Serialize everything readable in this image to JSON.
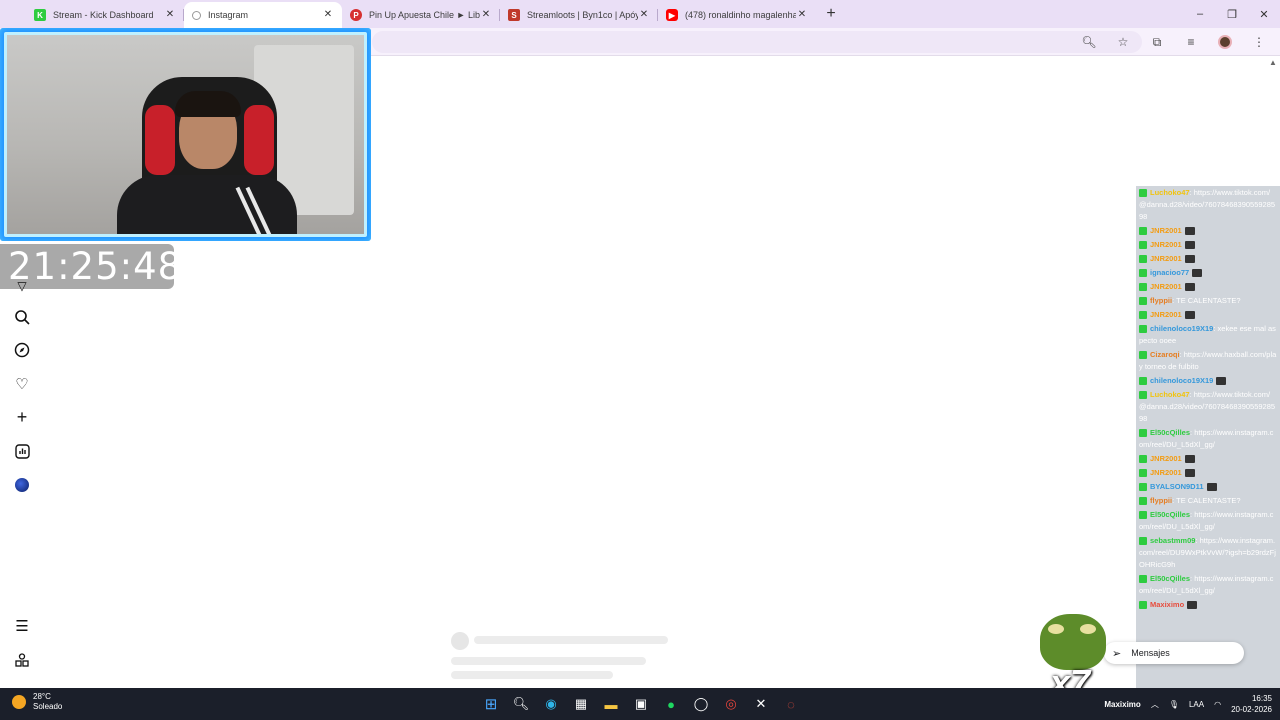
{
  "tabs": [
    {
      "title": "Stream - Kick Dashboard",
      "favicon": "kick-icon",
      "color": "#2ecc40",
      "active": false
    },
    {
      "title": "Instagram",
      "favicon": "loading-icon",
      "color": "#999999",
      "active": true
    },
    {
      "title": "Pin Up Apuesta Chile ► Libro D",
      "favicon": "pinup-icon",
      "color": "#d63031",
      "active": false
    },
    {
      "title": "Streamloots | Byn1co | Apóyam",
      "favicon": "streamloots-icon",
      "color": "#c0392b",
      "active": false
    },
    {
      "title": "(478) ronaldinho magalenha - Y",
      "favicon": "youtube-icon",
      "color": "#ff0000",
      "active": false
    }
  ],
  "window_controls": {
    "minimize": "–",
    "restore": "❐",
    "close": "✕"
  },
  "clock": "21:25:48",
  "chat": [
    {
      "user": "Luchoko47",
      "user_color": "#f1c40f",
      "text": "https://www.tiktok.com/@danna.d28/video/7607846839055928598"
    },
    {
      "user": "JNR2001",
      "user_color": "#f39c12",
      "text": ""
    },
    {
      "user": "JNR2001",
      "user_color": "#f39c12",
      "text": ""
    },
    {
      "user": "JNR2001",
      "user_color": "#f39c12",
      "text": ""
    },
    {
      "user": "ignacioo77",
      "user_color": "#3498db",
      "text": ""
    },
    {
      "user": "JNR2001",
      "user_color": "#f39c12",
      "text": ""
    },
    {
      "user": "flyppii",
      "user_color": "#e67e22",
      "text": "TE CALENTASTE?"
    },
    {
      "user": "JNR2001",
      "user_color": "#f39c12",
      "text": ""
    },
    {
      "user": "chilenoloco19X19",
      "user_color": "#3498db",
      "text": "xekee ese mal aspecto ooee"
    },
    {
      "user": "Cizaroqi",
      "user_color": "#e67e22",
      "text": "https://www.haxball.com/play torneo de fulbito"
    },
    {
      "user": "chilenoloco19X19",
      "user_color": "#3498db",
      "text": ""
    },
    {
      "user": "Luchoko47",
      "user_color": "#f1c40f",
      "text": "https://www.tiktok.com/@danna.d28/video/7607846839055928598"
    },
    {
      "user": "El50cQilles",
      "user_color": "#2ecc40",
      "text": "https://www.instagram.com/reel/DU_L5dXl_gg/"
    },
    {
      "user": "JNR2001",
      "user_color": "#f39c12",
      "text": ""
    },
    {
      "user": "JNR2001",
      "user_color": "#f39c12",
      "text": ""
    },
    {
      "user": "BYALSON9D11",
      "user_color": "#3498db",
      "text": ""
    },
    {
      "user": "flyppii",
      "user_color": "#e67e22",
      "text": "TE CALENTASTE?"
    },
    {
      "user": "El50cQilles",
      "user_color": "#2ecc40",
      "text": "https://www.instagram.com/reel/DU_L5dXl_gg/"
    },
    {
      "user": "sebastmm09",
      "user_color": "#2ecc40",
      "text": "https://www.instagram.com/reel/DU9WxPtkVvW/?igsh=b29rdzFjOHRicG9h"
    },
    {
      "user": "El50cQilles",
      "user_color": "#2ecc40",
      "text": "https://www.instagram.com/reel/DU_L5dXl_gg/"
    },
    {
      "user": "Maxiximo",
      "user_color": "#e74c3c",
      "text": ""
    }
  ],
  "messages_button": {
    "label": "Mensajes"
  },
  "frog_text": "x7",
  "weather": {
    "temp": "28°C",
    "condition": "Soleado"
  },
  "tray": {
    "lang": "LAA",
    "time": "16:35",
    "date": "20-02-2026"
  },
  "overlay_user": "Maxiximo"
}
